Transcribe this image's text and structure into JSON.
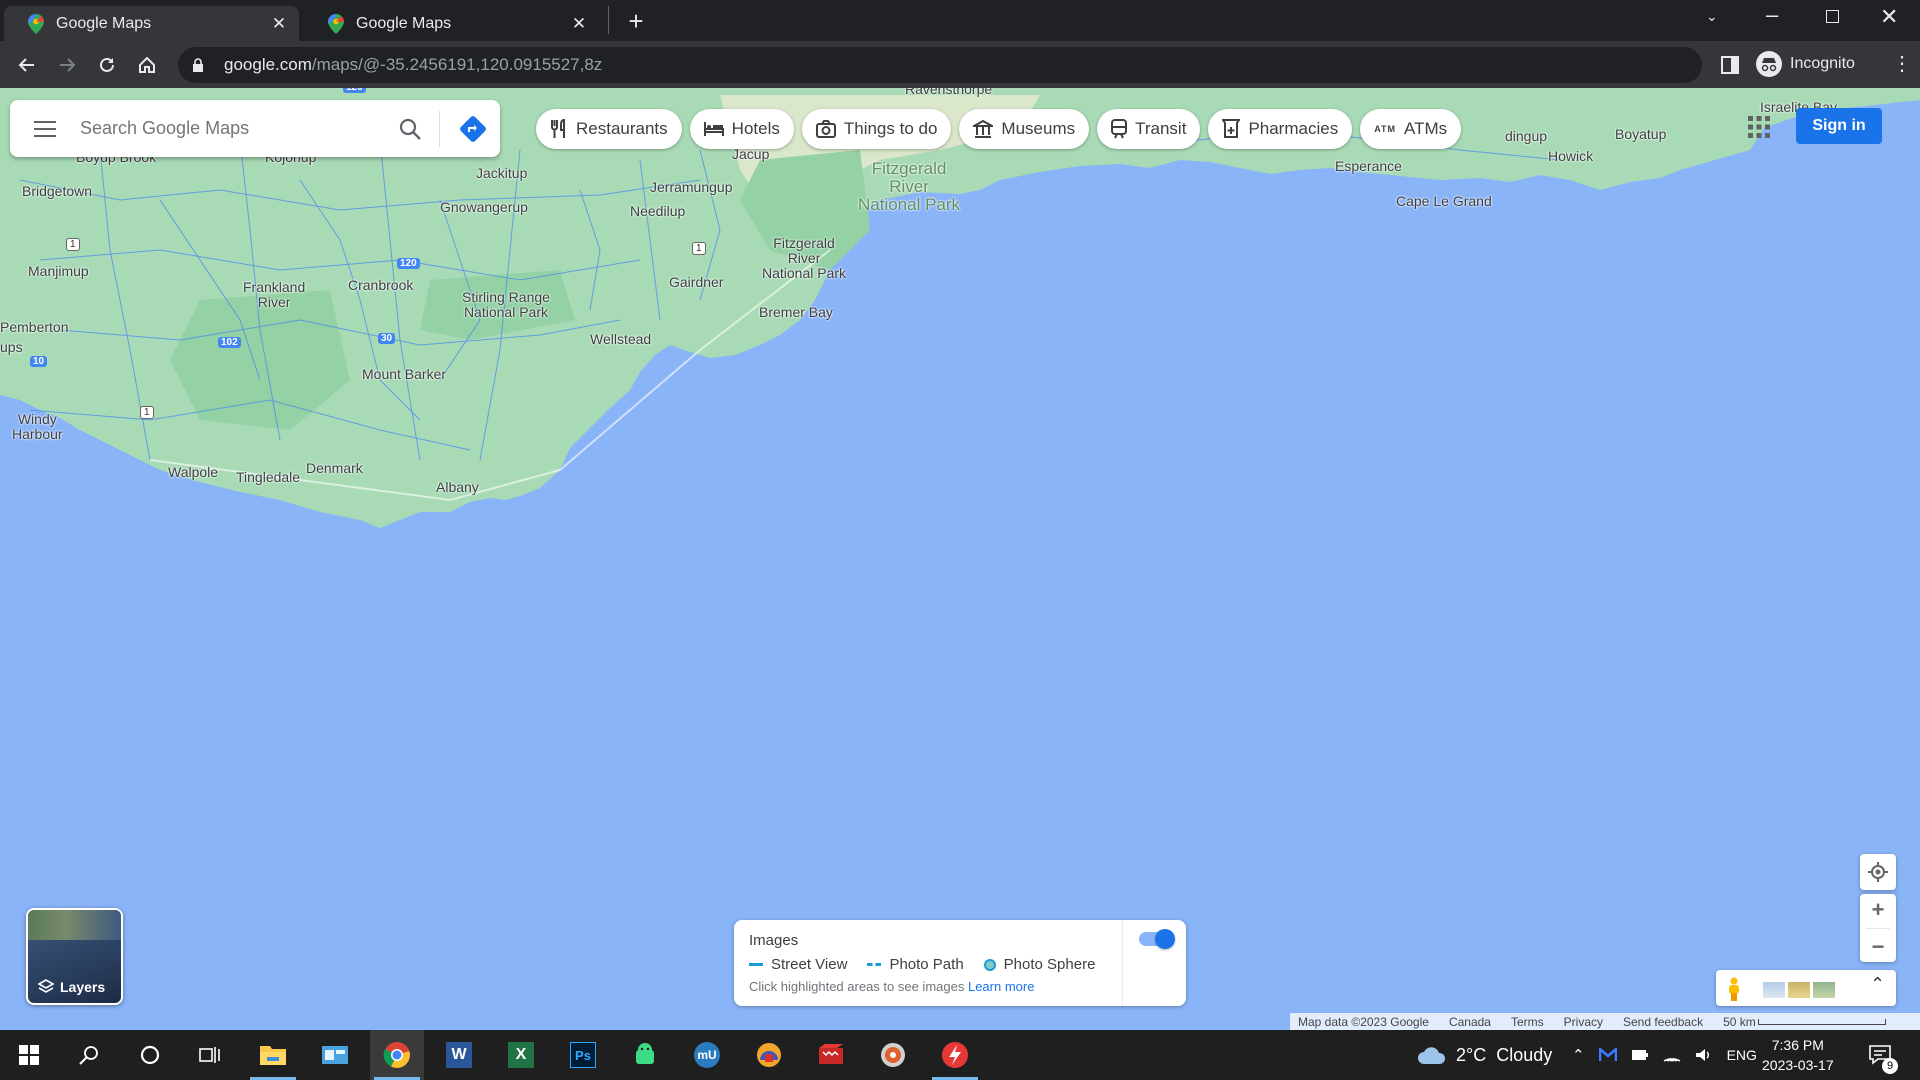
{
  "tabs": [
    {
      "title": "Google Maps",
      "active": true
    },
    {
      "title": "Google Maps",
      "active": false
    }
  ],
  "window_controls": [
    "chevron-down",
    "minimize",
    "restore",
    "close"
  ],
  "address_bar": {
    "host": "google.com",
    "path": "/maps/@-35.2456191,120.0915527,8z"
  },
  "profile": {
    "label": "Incognito"
  },
  "search": {
    "placeholder": "Search Google Maps"
  },
  "chips": [
    {
      "label": "Restaurants",
      "icon": "fork-knife-icon"
    },
    {
      "label": "Hotels",
      "icon": "bed-icon"
    },
    {
      "label": "Things to do",
      "icon": "camera-icon"
    },
    {
      "label": "Museums",
      "icon": "museum-icon"
    },
    {
      "label": "Transit",
      "icon": "train-icon"
    },
    {
      "label": "Pharmacies",
      "icon": "pharmacy-icon"
    },
    {
      "label": "ATMs",
      "icon": "atm-icon"
    }
  ],
  "atm_icon_text": "ATM",
  "sign_in": "Sign in",
  "map_labels": {
    "ravensthorpe": "Ravensthorpe",
    "boyup_brook": "Boyup Brook",
    "kojonup": "Kojonup",
    "jacup": "Jacup",
    "dingup": "dingup",
    "boyatup": "Boyatup",
    "howick": "Howick",
    "israelite_bay": "Israelite Bay",
    "esperance": "Esperance",
    "cape_le_grand": "Cape Le Grand",
    "bridgetown": "Bridgetown",
    "jackitup": "Jackitup",
    "jerramungup": "Jerramungup",
    "gnowangerup": "Gnowangerup",
    "needilup": "Needilup",
    "fitzgerald_np": "Fitzgerald\nRiver\nNational Park",
    "fitzgerald_river_np": "Fitzgerald\nRiver\nNational Park",
    "manjimup": "Manjimup",
    "frankland_river": "Frankland\nRiver",
    "cranbrook": "Cranbrook",
    "stirling_range": "Stirling Range\nNational Park",
    "gairdner": "Gairdner",
    "bremer_bay": "Bremer Bay",
    "pemberton": "Pemberton",
    "wellstead": "Wellstead",
    "mount_barker": "Mount Barker",
    "windy_harbour": "Windy\nHarbour",
    "walpole": "Walpole",
    "tingledale": "Tingledale",
    "denmark": "Denmark",
    "albany": "Albany",
    "ups": "ups"
  },
  "road_shields": [
    "120",
    "1",
    "120",
    "30",
    "102",
    "10",
    "1",
    "1"
  ],
  "layers": {
    "label": "Layers"
  },
  "images_panel": {
    "title": "Images",
    "legend": [
      "Street View",
      "Photo Path",
      "Photo Sphere"
    ],
    "hint": "Click highlighted areas to see images",
    "learn_more": "Learn more",
    "toggle_on": true
  },
  "footer": {
    "map_data": "Map data ©2023 Google",
    "country": "Canada",
    "terms": "Terms",
    "privacy": "Privacy",
    "feedback": "Send feedback",
    "scale": "50 km"
  },
  "taskbar": {
    "apps": [
      "windows-start",
      "search",
      "cortana",
      "task-view",
      "file-explorer",
      "control-panel",
      "chrome",
      "word",
      "excel",
      "photoshop",
      "android-emulator",
      "mu-app",
      "vpn-app",
      "video-app",
      "media-player",
      "power-app"
    ],
    "word_letter": "W",
    "excel_letter": "X",
    "photoshop_letters": "Ps",
    "mu_letters": "mU",
    "weather": "2°C  Cloudy",
    "language": "ENG",
    "time": "7:36 PM",
    "date": "2023-03-17",
    "notifications": "9"
  }
}
